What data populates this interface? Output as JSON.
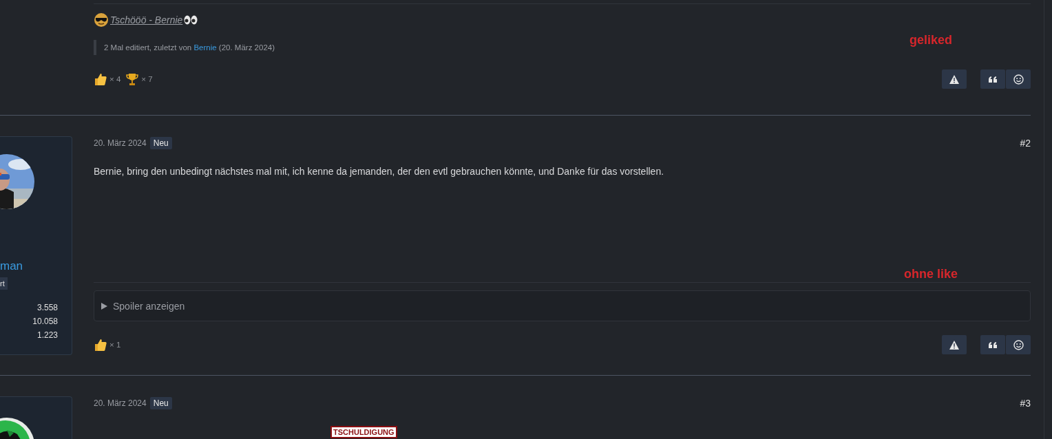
{
  "posts": [
    {
      "kind": "partial",
      "signature": {
        "text": "Tschööö - Bernie"
      },
      "edit_note": {
        "prefix": "2 Mal editiert, zuletzt von ",
        "user": "Bernie",
        "suffix": " (20. März 2024)"
      },
      "annotation": "geliked",
      "reactions": [
        {
          "kind": "like",
          "count": "× 4"
        },
        {
          "kind": "trophy",
          "count": "× 7"
        }
      ]
    },
    {
      "kind": "full",
      "author": {
        "name": "man",
        "badge": "rt",
        "stats": [
          "3.558",
          "10.058",
          "1.223"
        ]
      },
      "date": "20. März 2024",
      "badge": "Neu",
      "number": "#2",
      "body": "Bernie, bring den unbedingt nächstes mal mit, ich kenne da jemanden, der den evtl gebrauchen könnte, und Danke für das vorstellen.",
      "annotation": "ohne like",
      "spoiler": "Spoiler anzeigen",
      "reactions": [
        {
          "kind": "like",
          "count": "× 1"
        }
      ]
    },
    {
      "kind": "cut",
      "date": "20. März 2024",
      "badge": "Neu",
      "number": "#3",
      "sticker": "TSCHULDIGUNG"
    }
  ]
}
